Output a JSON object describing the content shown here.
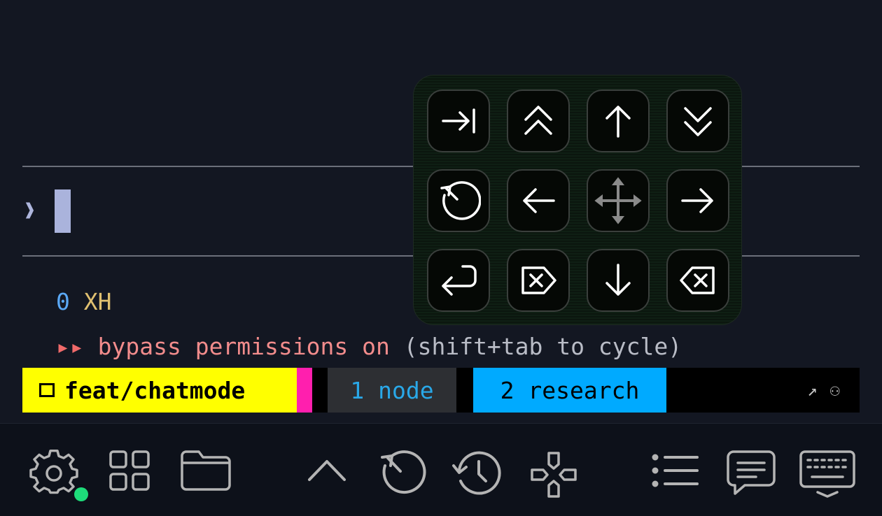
{
  "terminal": {
    "prompt_glyph": "❱",
    "status_number": "0",
    "status_code": "XH",
    "bypass_arrows": "▸▸",
    "bypass_text": "bypass permissions on",
    "bypass_hint": " (shift+tab to cycle)"
  },
  "tmux": {
    "branch": "feat/chatmode",
    "window_1": "1 node",
    "window_2": "2 research",
    "right_arrow": "↗",
    "right_face": "⚇"
  },
  "keypad": {
    "keys": [
      "tab-icon",
      "page-up-icon",
      "arrow-up-icon",
      "page-down-icon",
      "undo-icon",
      "arrow-left-icon",
      "move-icon",
      "arrow-right-icon",
      "enter-icon",
      "delete-icon",
      "arrow-down-icon",
      "backspace-icon"
    ]
  },
  "toolbar": {
    "icons": [
      "gear-icon",
      "grid-icon",
      "folder-icon",
      "chevron-up-icon",
      "undo-icon",
      "history-icon",
      "gamepad-icon",
      "list-icon",
      "chat-icon",
      "keyboard-icon"
    ]
  },
  "colors": {
    "status_dot": "#1edc7a",
    "branch_bg": "#ffff00",
    "research_bg": "#00aaff",
    "accent_pink": "#ff1fae"
  }
}
